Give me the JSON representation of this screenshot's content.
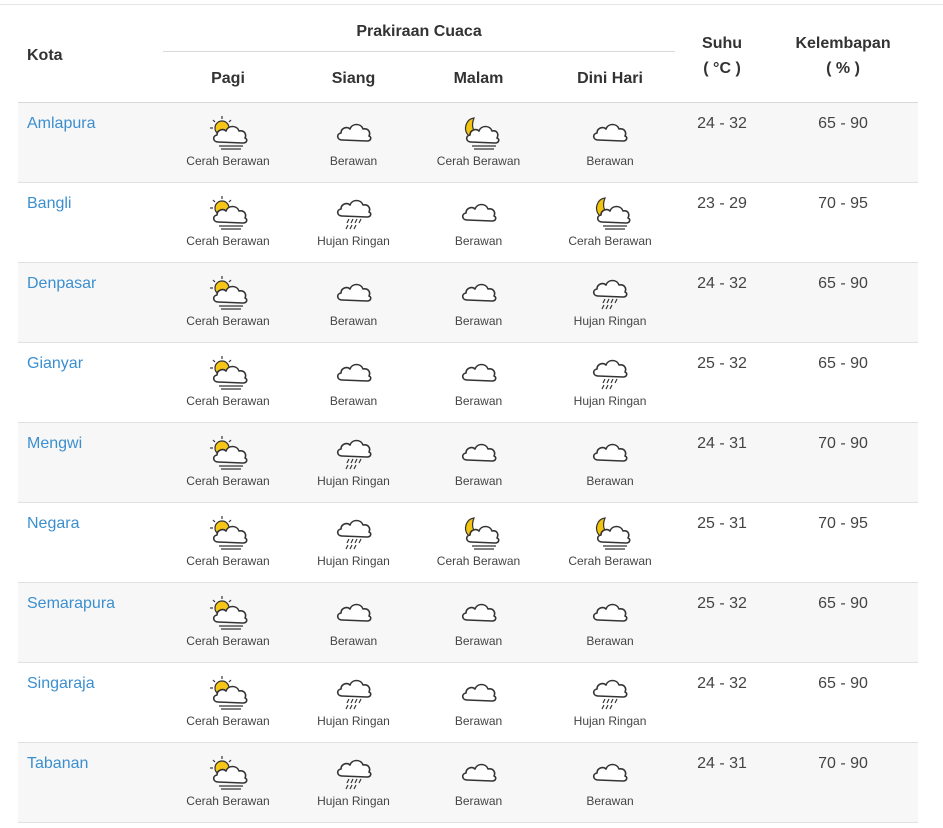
{
  "table": {
    "header": {
      "kota": "Kota",
      "group": "Prakiraan Cuaca",
      "periods": [
        "Pagi",
        "Siang",
        "Malam",
        "Dini Hari"
      ],
      "suhu_line1": "Suhu",
      "suhu_line2": "( °C )",
      "kelembapan_line1": "Kelembapan",
      "kelembapan_line2": "( % )"
    },
    "rows": [
      {
        "city": "Amlapura",
        "forecasts": [
          {
            "icon": "sun-cloud-icon",
            "label": "Cerah Berawan"
          },
          {
            "icon": "cloud-icon",
            "label": "Berawan"
          },
          {
            "icon": "moon-cloud-icon",
            "label": "Cerah Berawan"
          },
          {
            "icon": "cloud-icon",
            "label": "Berawan"
          }
        ],
        "suhu": "24 - 32",
        "kelembapan": "65 - 90"
      },
      {
        "city": "Bangli",
        "forecasts": [
          {
            "icon": "sun-cloud-icon",
            "label": "Cerah Berawan"
          },
          {
            "icon": "rain-cloud-icon",
            "label": "Hujan Ringan"
          },
          {
            "icon": "cloud-icon",
            "label": "Berawan"
          },
          {
            "icon": "moon-cloud-icon",
            "label": "Cerah Berawan"
          }
        ],
        "suhu": "23 - 29",
        "kelembapan": "70 - 95"
      },
      {
        "city": "Denpasar",
        "forecasts": [
          {
            "icon": "sun-cloud-icon",
            "label": "Cerah Berawan"
          },
          {
            "icon": "cloud-icon",
            "label": "Berawan"
          },
          {
            "icon": "cloud-icon",
            "label": "Berawan"
          },
          {
            "icon": "rain-cloud-icon",
            "label": "Hujan Ringan"
          }
        ],
        "suhu": "24 - 32",
        "kelembapan": "65 - 90"
      },
      {
        "city": "Gianyar",
        "forecasts": [
          {
            "icon": "sun-cloud-icon",
            "label": "Cerah Berawan"
          },
          {
            "icon": "cloud-icon",
            "label": "Berawan"
          },
          {
            "icon": "cloud-icon",
            "label": "Berawan"
          },
          {
            "icon": "rain-cloud-icon",
            "label": "Hujan Ringan"
          }
        ],
        "suhu": "25 - 32",
        "kelembapan": "65 - 90"
      },
      {
        "city": "Mengwi",
        "forecasts": [
          {
            "icon": "sun-cloud-icon",
            "label": "Cerah Berawan"
          },
          {
            "icon": "rain-cloud-icon",
            "label": "Hujan Ringan"
          },
          {
            "icon": "cloud-icon",
            "label": "Berawan"
          },
          {
            "icon": "cloud-icon",
            "label": "Berawan"
          }
        ],
        "suhu": "24 - 31",
        "kelembapan": "70 - 90"
      },
      {
        "city": "Negara",
        "forecasts": [
          {
            "icon": "sun-cloud-icon",
            "label": "Cerah Berawan"
          },
          {
            "icon": "rain-cloud-icon",
            "label": "Hujan Ringan"
          },
          {
            "icon": "moon-cloud-icon",
            "label": "Cerah Berawan"
          },
          {
            "icon": "moon-cloud-icon",
            "label": "Cerah Berawan"
          }
        ],
        "suhu": "25 - 31",
        "kelembapan": "70 - 95"
      },
      {
        "city": "Semarapura",
        "forecasts": [
          {
            "icon": "sun-cloud-icon",
            "label": "Cerah Berawan"
          },
          {
            "icon": "cloud-icon",
            "label": "Berawan"
          },
          {
            "icon": "cloud-icon",
            "label": "Berawan"
          },
          {
            "icon": "cloud-icon",
            "label": "Berawan"
          }
        ],
        "suhu": "25 - 32",
        "kelembapan": "65 - 90"
      },
      {
        "city": "Singaraja",
        "forecasts": [
          {
            "icon": "sun-cloud-icon",
            "label": "Cerah Berawan"
          },
          {
            "icon": "rain-cloud-icon",
            "label": "Hujan Ringan"
          },
          {
            "icon": "cloud-icon",
            "label": "Berawan"
          },
          {
            "icon": "rain-cloud-icon",
            "label": "Hujan Ringan"
          }
        ],
        "suhu": "24 - 32",
        "kelembapan": "65 - 90"
      },
      {
        "city": "Tabanan",
        "forecasts": [
          {
            "icon": "sun-cloud-icon",
            "label": "Cerah Berawan"
          },
          {
            "icon": "rain-cloud-icon",
            "label": "Hujan Ringan"
          },
          {
            "icon": "cloud-icon",
            "label": "Berawan"
          },
          {
            "icon": "cloud-icon",
            "label": "Berawan"
          }
        ],
        "suhu": "24 - 31",
        "kelembapan": "70 - 90"
      }
    ]
  },
  "colors": {
    "city_link": "#3b8fd0",
    "row_alt": "#f7f7f7",
    "sun": "#f5c518",
    "moon": "#f2c40f"
  }
}
